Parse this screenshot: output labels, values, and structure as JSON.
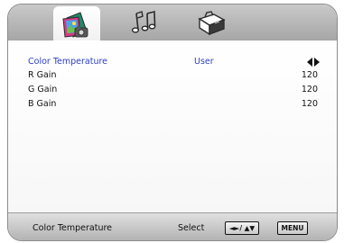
{
  "tabs": [
    {
      "name": "picture-tab",
      "icon": "picture-icon",
      "selected": true
    },
    {
      "name": "sound-tab",
      "icon": "music-notes-icon",
      "selected": false
    },
    {
      "name": "setup-tab",
      "icon": "toolbox-icon",
      "selected": false
    }
  ],
  "menu": {
    "rows": [
      {
        "label": "Color Temperature",
        "value": "User",
        "selected": true
      },
      {
        "label": "R Gain",
        "value": "120"
      },
      {
        "label": "G Gain",
        "value": "120"
      },
      {
        "label": "B Gain",
        "value": "120"
      }
    ]
  },
  "footer": {
    "help_text": "Color Temperature",
    "select_label": "Select",
    "nav_key": "◄►/ ▲▼",
    "menu_key": "MENU"
  },
  "colors": {
    "selected_text": "#2b3ec7",
    "band": "#b8b8b8"
  }
}
